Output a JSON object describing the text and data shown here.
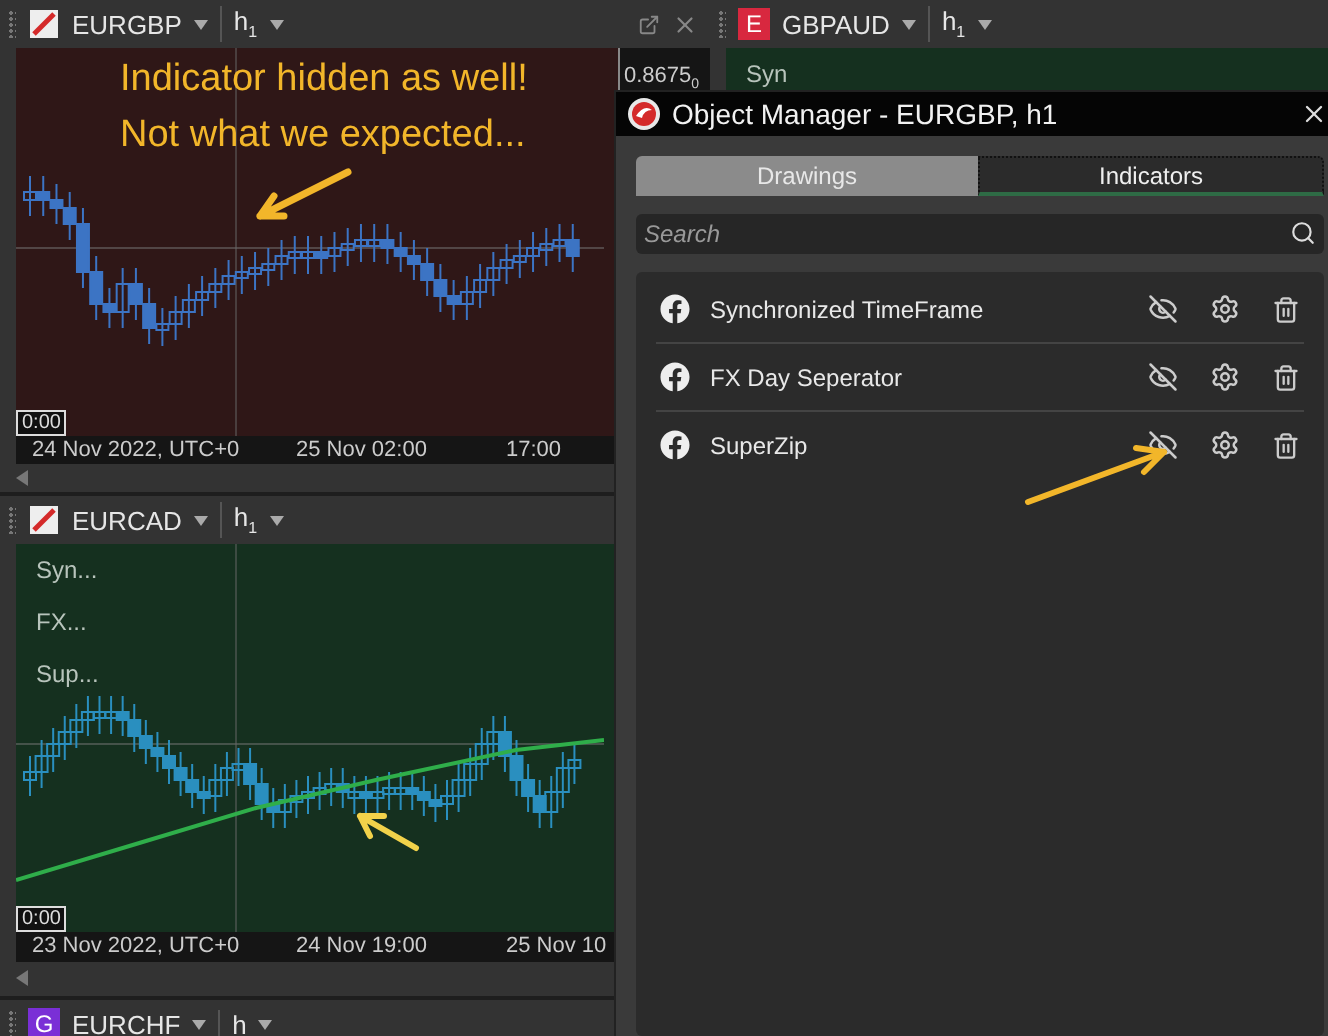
{
  "charts": [
    {
      "symbol": "EURGBP",
      "symbol_icon": {
        "kind": "slash"
      },
      "timeframe": "h$_{1}$",
      "color": "#2f1717",
      "price_label": "0.8675$_{0}$",
      "window_controls": true,
      "annotation": [
        "Indicator hidden as well!",
        "Not what we expected..."
      ],
      "time_marker": "0:00",
      "time_labels": [
        "24 Nov 2022, UTC+0",
        "25 Nov 02:00",
        "17:00"
      ],
      "indicator_line": false
    },
    {
      "symbol": "GBPAUD",
      "symbol_icon": {
        "kind": "letter",
        "letter": "E",
        "color": "#d8283f"
      },
      "timeframe": "h$_{1}$",
      "color": "#15301f",
      "legend": [
        "Syn"
      ]
    },
    {
      "symbol": "EURCAD",
      "symbol_icon": {
        "kind": "slash"
      },
      "timeframe": "h$_{1}$",
      "color": "#15301f",
      "window_controls": false,
      "legend": [
        "Syn...",
        "FX...",
        "Sup..."
      ],
      "time_marker": "0:00",
      "time_labels": [
        "23 Nov 2022, UTC+0",
        "24 Nov 19:00",
        "25 Nov 10"
      ],
      "indicator_line": true
    },
    {
      "symbol": "EURCHF",
      "symbol_icon": {
        "kind": "letter",
        "letter": "G",
        "color": "#7a2fd6"
      },
      "timeframe": "h"
    }
  ],
  "object_manager": {
    "title": "Object Manager - EURGBP, h1",
    "tabs": [
      {
        "label": "Drawings",
        "selected": false
      },
      {
        "label": "Indicators",
        "selected": true
      }
    ],
    "search": {
      "placeholder": "Search"
    },
    "items": [
      {
        "name": "Synchronized TimeFrame",
        "visible": false
      },
      {
        "name": "FX Day Seperator",
        "visible": false
      },
      {
        "name": "SuperZip",
        "visible": false
      }
    ]
  }
}
